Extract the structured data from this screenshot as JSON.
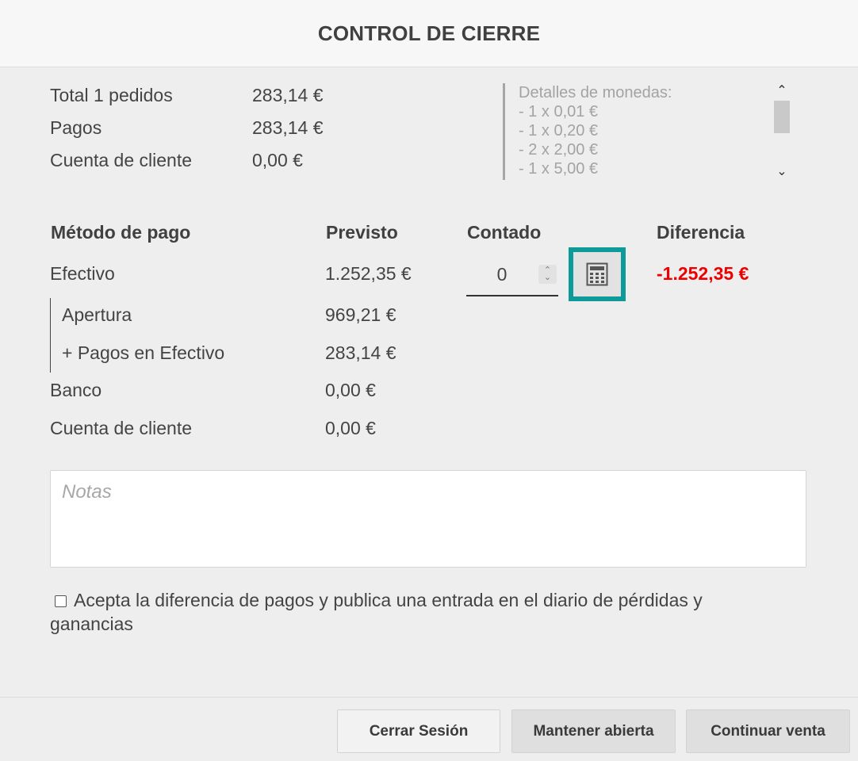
{
  "header": {
    "title": "CONTROL DE CIERRE"
  },
  "summary": [
    {
      "label": "Total 1 pedidos",
      "value": "283,14 €"
    },
    {
      "label": "Pagos",
      "value": "283,14 €"
    },
    {
      "label": "Cuenta de cliente",
      "value": "0,00 €"
    }
  ],
  "coins": {
    "title": "Detalles de monedas:",
    "lines": [
      "- 1 x 0,01 €",
      "- 1 x 0,20 €",
      "- 2 x 2,00 €",
      "- 1 x 5,00 €"
    ]
  },
  "table": {
    "headers": {
      "method": "Método de pago",
      "expected": "Previsto",
      "counted": "Contado",
      "difference": "Diferencia"
    },
    "cash": {
      "label": "Efectivo",
      "expected": "1.252,35 €",
      "counted_value": "0",
      "difference": "-1.252,35 €"
    },
    "cash_details": [
      {
        "label": "Apertura",
        "value": "969,21 €"
      },
      {
        "label": "+ Pagos en Efectivo",
        "value": "283,14 €"
      }
    ],
    "bank": {
      "label": "Banco",
      "value": "0,00 €"
    },
    "customer_account": {
      "label": "Cuenta de cliente",
      "value": "0,00 €"
    }
  },
  "notes": {
    "placeholder": "Notas"
  },
  "accept": {
    "label": "Acepta la diferencia de pagos y publica una entrada en el diario de pérdidas y ganancias"
  },
  "buttons": {
    "close_session": "Cerrar Sesión",
    "keep_open": "Mantener abierta",
    "continue_sale": "Continuar venta"
  },
  "icons": {
    "calculator": "calculator-icon"
  },
  "colors": {
    "accent": "#0f9a9a",
    "negative": "#ef0000"
  }
}
